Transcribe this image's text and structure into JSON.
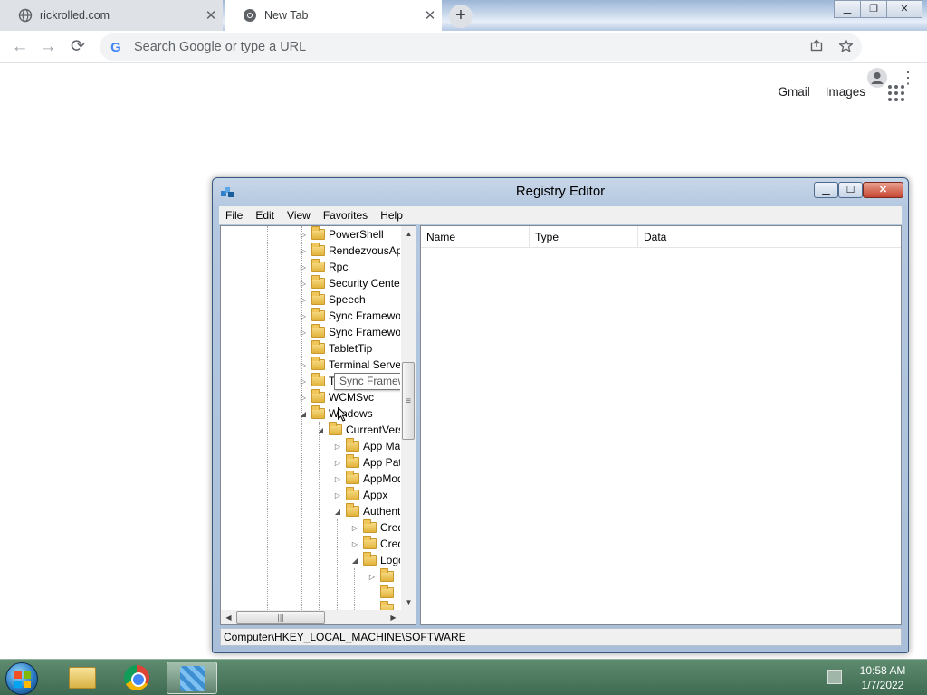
{
  "browser": {
    "tabs": [
      {
        "title": "rickrolled.com",
        "close": "✕"
      },
      {
        "title": "New Tab",
        "close": "✕"
      }
    ],
    "new_tab": "+",
    "window_controls": {
      "minimize": "▁",
      "restore": "❐",
      "close": "✕"
    },
    "nav": {
      "back": "←",
      "forward": "→",
      "reload": "⟳"
    },
    "omnibox": {
      "placeholder": "Search Google or type a URL",
      "google_glyph": "G"
    },
    "ntp_links": {
      "gmail": "Gmail",
      "images": "Images"
    },
    "menu": "⋮"
  },
  "regedit": {
    "title": "Registry Editor",
    "controls": {
      "minimize": "▁",
      "maximize": "☐",
      "close": "✕"
    },
    "menu": [
      "File",
      "Edit",
      "View",
      "Favorites",
      "Help"
    ],
    "tree": [
      {
        "label": "PowerShell",
        "expander": "▷"
      },
      {
        "label": "RendezvousApps",
        "expander": "▷"
      },
      {
        "label": "Rpc",
        "expander": "▷"
      },
      {
        "label": "Security Center",
        "expander": "▷"
      },
      {
        "label": "Speech",
        "expander": "▷"
      },
      {
        "label": "Sync Framework",
        "expander": "▷"
      },
      {
        "label": "Sync Framework",
        "expander": "▷"
      },
      {
        "label": "TabletTip",
        "expander": ""
      },
      {
        "label": "Terminal Server",
        "expander": "▷"
      },
      {
        "label": "TPG",
        "expander": "▷"
      },
      {
        "label": "WCMSvc",
        "expander": "▷"
      },
      {
        "label": "Windows",
        "expander": "◢"
      },
      {
        "label": "CurrentVersion",
        "expander": "◢"
      },
      {
        "label": "App Management",
        "expander": "▷"
      },
      {
        "label": "App Paths",
        "expander": "▷"
      },
      {
        "label": "AppModel",
        "expander": "▷"
      },
      {
        "label": "Appx",
        "expander": "▷"
      },
      {
        "label": "Authentication",
        "expander": "◢"
      },
      {
        "label": "Credential Providers",
        "expander": "▷"
      },
      {
        "label": "Credential Provider Filters",
        "expander": "▷"
      },
      {
        "label": "LogonUI",
        "expander": "◢"
      },
      {
        "label": "",
        "expander": "▷"
      },
      {
        "label": "",
        "expander": ""
      },
      {
        "label": "",
        "expander": ""
      }
    ],
    "tooltip": "Sync Framework",
    "columns": [
      "Name",
      "Type",
      "Data"
    ],
    "status": "Computer\\HKEY_LOCAL_MACHINE\\SOFTWARE",
    "scroll": {
      "up": "▲",
      "down": "▼",
      "left": "◀",
      "right": "▶",
      "grip_v": "≡",
      "grip_h": "|||"
    }
  },
  "taskbar": {
    "time": "10:58 AM",
    "date": "1/7/2022"
  }
}
